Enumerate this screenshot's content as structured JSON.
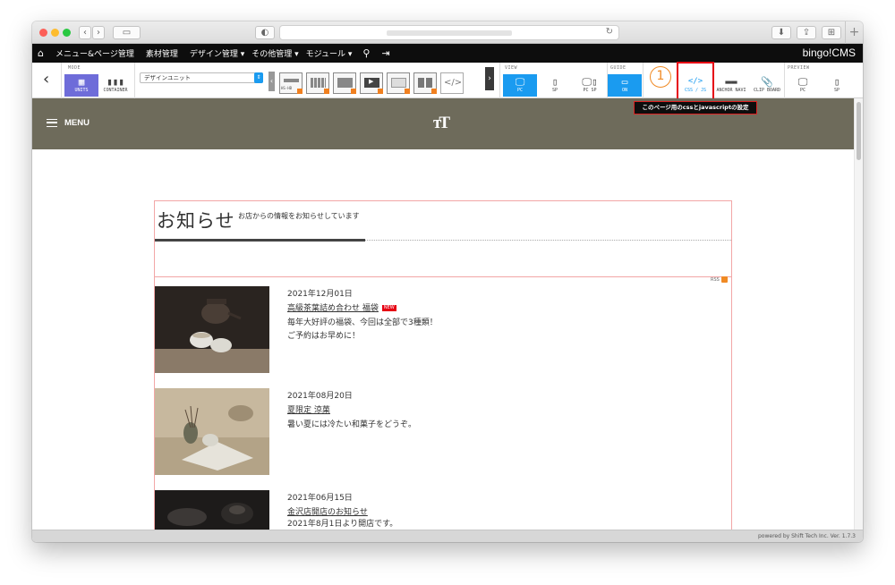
{
  "browser": {
    "nav_back": "‹",
    "nav_forward": "›",
    "sidebar_toggle": "▭",
    "privacy": "◐",
    "reload": "↻",
    "downloads": "⬇",
    "share": "⇪",
    "tabs": "⊞",
    "new_tab": "+"
  },
  "adminbar": {
    "home_icon": "⌂",
    "items": [
      "メニュー&ページ管理",
      "素材管理",
      "デザイン管理 ▾",
      "その他管理 ▾",
      "モジュール ▾"
    ],
    "search_icon": "⚲",
    "exit_icon": "⇥",
    "brand": "bingo!CMS"
  },
  "toolbar": {
    "back": "‹",
    "mode_label": "MODE",
    "units": "UNITS",
    "container": "CONTAINER",
    "select_value": "デザインユニット",
    "prev": "‹",
    "next": "›",
    "view_label": "VIEW",
    "guide_label": "GUIDE",
    "preview_label": "PREVIEW",
    "code_glyph": "</>",
    "view_pc": "PC",
    "view_sp": "SP",
    "view_pcsp": "PC SP",
    "guide_on": "ON",
    "step_number": "1",
    "css_js": "CSS / JS",
    "anchor": "ANCHOR NAVI",
    "clip": "CLIP BOARD",
    "preview_pc": "PC",
    "preview_sp": "SP",
    "tooltip": "このページ用のcssとjavascriptの設定"
  },
  "site": {
    "menu": "MENU",
    "logo": "тT",
    "title": "お知らせ",
    "subtitle": "お店からの情報をお知らせしています",
    "rss": "RSS",
    "news": [
      {
        "date": "2021年12月01日",
        "title": "高級茶葉詰め合わせ 福袋",
        "badge": "NEW",
        "desc1": "毎年大好評の福袋、今回は全部で3種類！",
        "desc2": "ご予約はお早めに！"
      },
      {
        "date": "2021年08月20日",
        "title": "夏限定 涼菓",
        "badge": "",
        "desc1": "暑い夏には冷たい和菓子をどうぞ。",
        "desc2": ""
      },
      {
        "date": "2021年06月15日",
        "title": "金沢店開店のお知らせ",
        "badge": "",
        "desc1": "2021年8月1日より開店です。",
        "desc2": ""
      }
    ],
    "footer": "powered by Shift Tech Inc. Ver. 1.7.3"
  },
  "colors": {
    "accent_blue": "#1a9bf0",
    "mode_purple": "#6e6cd9",
    "header_olive": "#6e6b5b",
    "highlight_red": "#e60012",
    "step_orange": "#f08a24"
  }
}
